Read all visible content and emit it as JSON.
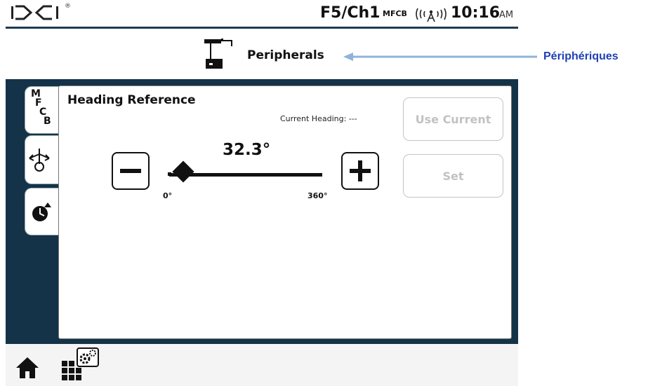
{
  "statusbar": {
    "logo": "DCI",
    "frequency": "F5/Ch1",
    "mode": "MFCB",
    "time": "10:16",
    "ampm": "AM",
    "icons": [
      "dci-logo-icon",
      "signal-tower-icon"
    ]
  },
  "titlebar": {
    "title": "Peripherals",
    "icon": "peripherals-icon"
  },
  "tabs": [
    {
      "name": "mfcb",
      "label": "MFCB"
    },
    {
      "name": "heading",
      "icon": "heading-reference-icon",
      "active": true
    },
    {
      "name": "clock",
      "icon": "clock-icon"
    }
  ],
  "heading_reference": {
    "title": "Heading Reference",
    "current_heading": "Current Heading: ---",
    "value": "32.3°",
    "min_label": "0°",
    "max_label": "360°",
    "slider_fraction": 0.09,
    "use_current_label": "Use Current",
    "set_label": "Set"
  },
  "bottombar": {
    "icons": [
      "home-icon",
      "settings-grid-icon"
    ]
  },
  "annotation": {
    "label": "Périphériques"
  },
  "colors": {
    "panel": "#143349",
    "active_tab": "#2aa13d",
    "disabled": "#c2c2c2",
    "annotation": "#1f3fb5"
  }
}
